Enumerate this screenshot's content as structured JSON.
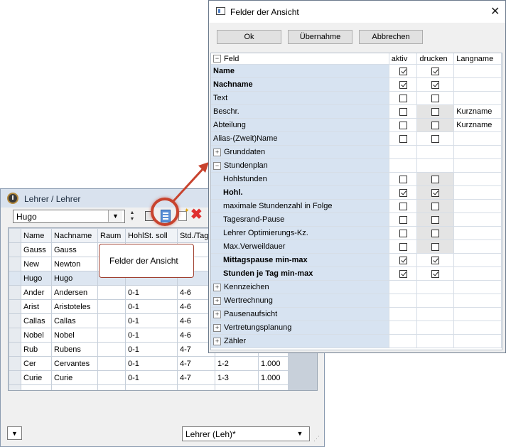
{
  "lehrer_window": {
    "title": "Lehrer / Lehrer",
    "selected_teacher": "Hugo",
    "columns": [
      "Name",
      "Nachname",
      "Raum",
      "HohlSt. soll",
      "Std./Tag",
      "",
      ""
    ],
    "rows": [
      [
        "Gauss",
        "Gauss",
        "",
        "",
        "",
        "",
        ""
      ],
      [
        "New",
        "Newton",
        "",
        "",
        "",
        "",
        ""
      ],
      [
        "Hugo",
        "Hugo",
        "",
        "",
        "",
        "",
        ""
      ],
      [
        "Ander",
        "Andersen",
        "",
        "0-1",
        "4-6",
        "",
        ""
      ],
      [
        "Arist",
        "Aristoteles",
        "",
        "0-1",
        "4-6",
        "",
        ""
      ],
      [
        "Callas",
        "Callas",
        "",
        "0-1",
        "4-6",
        "",
        ""
      ],
      [
        "Nobel",
        "Nobel",
        "",
        "0-1",
        "4-6",
        "",
        ""
      ],
      [
        "Rub",
        "Rubens",
        "",
        "0-1",
        "4-7",
        "",
        ""
      ],
      [
        "Cer",
        "Cervantes",
        "",
        "0-1",
        "4-7",
        "1-2",
        "1.000"
      ],
      [
        "Curie",
        "Curie",
        "",
        "0-1",
        "4-7",
        "1-3",
        "1.000"
      ]
    ],
    "selected_row": 2,
    "status_select": "Lehrer (Leh)*"
  },
  "callout": {
    "label": "Felder der Ansicht"
  },
  "felder_dialog": {
    "title": "Felder der Ansicht",
    "buttons": {
      "ok": "Ok",
      "uebernahme": "Übernahme",
      "abbrechen": "Abbrechen"
    },
    "columns": {
      "feld": "Feld",
      "aktiv": "aktiv",
      "drucken": "drucken",
      "langname": "Langname"
    },
    "rows": [
      {
        "label": "Name",
        "bold": true,
        "indent": 0,
        "aktiv": true,
        "drucken": true,
        "langname": ""
      },
      {
        "label": "Nachname",
        "bold": true,
        "indent": 0,
        "aktiv": true,
        "drucken": true,
        "langname": ""
      },
      {
        "label": "Text",
        "bold": false,
        "indent": 0,
        "aktiv": false,
        "drucken": false,
        "langname": ""
      },
      {
        "label": "Beschr.",
        "bold": false,
        "indent": 0,
        "aktiv": false,
        "drucken": false,
        "drucken_gray": true,
        "langname": "Kurzname"
      },
      {
        "label": "Abteilung",
        "bold": false,
        "indent": 0,
        "aktiv": false,
        "drucken": false,
        "drucken_gray": true,
        "langname": "Kurzname"
      },
      {
        "label": "Alias-(Zweit)Name",
        "bold": false,
        "indent": 0,
        "aktiv": false,
        "drucken": false,
        "langname": ""
      },
      {
        "label": "Grunddaten",
        "group": "+",
        "indent": 0
      },
      {
        "label": "Stundenplan",
        "group": "-",
        "indent": 0
      },
      {
        "label": "Hohlstunden",
        "bold": false,
        "indent": 1,
        "aktiv": false,
        "drucken": false,
        "drucken_gray": true,
        "langname": ""
      },
      {
        "label": "Hohl.",
        "bold": true,
        "indent": 1,
        "aktiv": true,
        "drucken": true,
        "drucken_gray": true,
        "langname": ""
      },
      {
        "label": "maximale Stundenzahl in Folge",
        "bold": false,
        "indent": 1,
        "aktiv": false,
        "drucken": false,
        "drucken_gray": true,
        "langname": ""
      },
      {
        "label": "Tagesrand-Pause",
        "bold": false,
        "indent": 1,
        "aktiv": false,
        "drucken": false,
        "drucken_gray": true,
        "langname": ""
      },
      {
        "label": "Lehrer Optimierungs-Kz.",
        "bold": false,
        "indent": 1,
        "aktiv": false,
        "drucken": false,
        "drucken_gray": true,
        "langname": ""
      },
      {
        "label": "Max.Verweildauer",
        "bold": false,
        "indent": 1,
        "aktiv": false,
        "drucken": false,
        "drucken_gray": true,
        "langname": ""
      },
      {
        "label": "Mittagspause min-max",
        "bold": true,
        "indent": 1,
        "aktiv": true,
        "drucken": true,
        "langname": ""
      },
      {
        "label": "Stunden je Tag min-max",
        "bold": true,
        "indent": 1,
        "aktiv": true,
        "drucken": true,
        "langname": ""
      },
      {
        "label": "Kennzeichen",
        "group": "+",
        "indent": 0
      },
      {
        "label": "Wertrechnung",
        "group": "+",
        "indent": 0
      },
      {
        "label": "Pausenaufsicht",
        "group": "+",
        "indent": 0
      },
      {
        "label": "Vertretungsplanung",
        "group": "+",
        "indent": 0
      },
      {
        "label": "Zähler",
        "group": "+",
        "indent": 0
      }
    ]
  },
  "colors": {
    "accent": "#c8432e",
    "feld_column": "#d7e3f1",
    "selected_row": "#dde6f1"
  }
}
